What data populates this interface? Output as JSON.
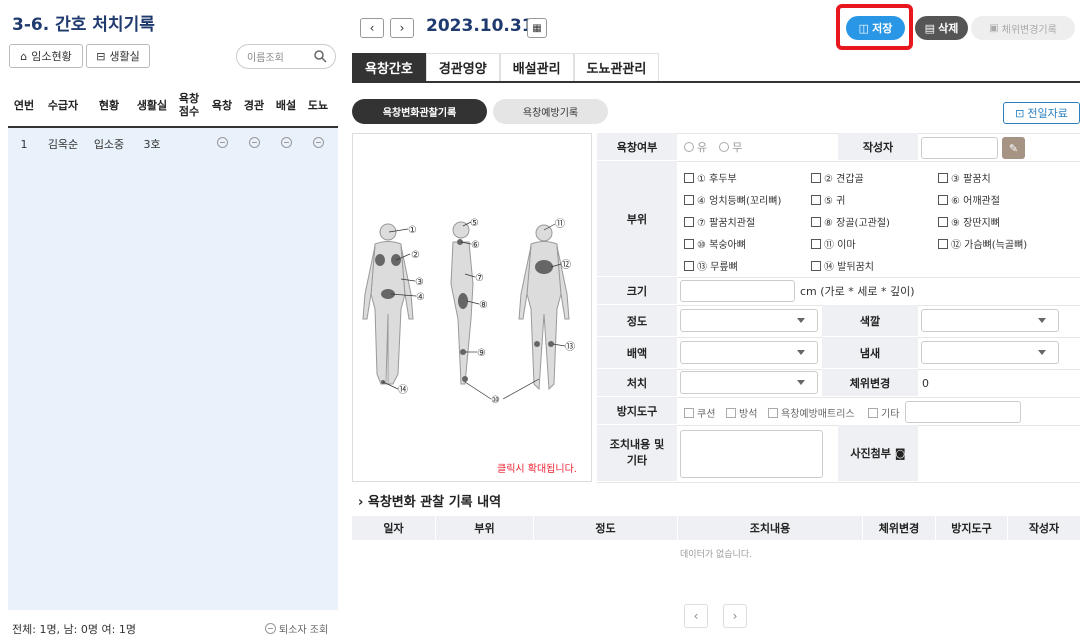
{
  "left": {
    "title": "3-6. 간호 처치기록",
    "admission_button": "임소현황",
    "living_room_button": "생활실",
    "search_placeholder": "이름조회",
    "columns": [
      "연번",
      "수급자",
      "현황",
      "생활실",
      "욕창\n점수",
      "욕창",
      "경관",
      "배설",
      "도뇨"
    ],
    "rows": [
      {
        "no": "1",
        "name": "김옥순",
        "status": "입소중",
        "room": "3호",
        "score": ""
      }
    ],
    "footer": "전체: 1명,  남: 0명  여: 1명",
    "retired_button": "퇴소자 조회"
  },
  "header": {
    "date": "2023.10.31",
    "save_label": "저장",
    "delete_label": "삭제",
    "position_change_label": "체위변경기록"
  },
  "tabs": [
    "욕창간호",
    "경관영양",
    "배설관리",
    "도뇨관관리"
  ],
  "subtabs": [
    "욕창변화관찰기록",
    "욕창예방기록"
  ],
  "previous_button": "전일자료",
  "body_map": {
    "note": "클릭시 확대됩니다.",
    "markers": [
      "①",
      "②",
      "③",
      "④",
      "⑤",
      "⑥",
      "⑦",
      "⑧",
      "⑨",
      "⑩",
      "⑪",
      "⑫",
      "⑬",
      "⑭"
    ]
  },
  "form": {
    "presence_label": "욕창여부",
    "presence_options": [
      "유",
      "무"
    ],
    "writer_label": "작성자",
    "site_label": "부위",
    "sites": [
      "① 후두부",
      "② 견갑골",
      "③ 팔꿈치",
      "④ 엉치등뼈(꼬리뼈)",
      "⑤ 귀",
      "⑥ 어깨관절",
      "⑦ 팔꿈치관절",
      "⑧ 장골(고관절)",
      "⑨ 장딴지뼈",
      "⑩ 복숭아뼈",
      "⑪ 이마",
      "⑫ 가슴뼈(늑골뼈)",
      "⑬ 무릎뼈",
      "⑭ 발뒤꿈치"
    ],
    "size_label": "크기",
    "size_unit": "cm  (가로 * 세로 * 깊이)",
    "degree_label": "정도",
    "color_label": "색깔",
    "discharge_label": "배액",
    "odor_label": "냄새",
    "treatment_label": "처치",
    "position_label": "체위변경",
    "position_value": "0",
    "device_label": "방지도구",
    "devices": [
      "쿠션",
      "방석",
      "욕창예방매트리스",
      "기타"
    ],
    "action_label": "조치내용 및\n기타",
    "photo_label": "사진첨부"
  },
  "history": {
    "title": "욕창변화 관찰 기록 내역",
    "columns": [
      "일자",
      "부위",
      "정도",
      "조치내용",
      "체위변경",
      "방지도구",
      "작성자"
    ],
    "empty_text": "데이터가 없습니다."
  },
  "colors": {
    "accent": "#2a97e6",
    "title": "#1f3a6e",
    "highlight": "#e8171d"
  }
}
